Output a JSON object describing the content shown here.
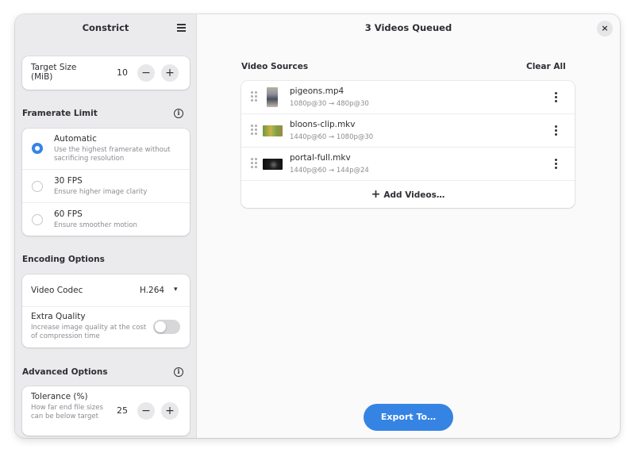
{
  "sidebar": {
    "title": "Constrict",
    "target_size": {
      "label": "Target Size (MiB)",
      "value": "10",
      "decrement": "−",
      "increment": "+"
    },
    "framerate": {
      "title": "Framerate Limit",
      "info": "i",
      "options": [
        {
          "label": "Automatic",
          "desc": "Use the highest framerate without sacrificing resolution",
          "selected": true
        },
        {
          "label": "30 FPS",
          "desc": "Ensure higher image clarity",
          "selected": false
        },
        {
          "label": "60 FPS",
          "desc": "Ensure smoother motion",
          "selected": false
        }
      ]
    },
    "encoding": {
      "title": "Encoding Options",
      "video_codec_label": "Video Codec",
      "video_codec_value": "H.264",
      "extra_quality_label": "Extra Quality",
      "extra_quality_desc": "Increase image quality at the cost of compression time",
      "extra_quality_on": false
    },
    "advanced": {
      "title": "Advanced Options",
      "info": "i",
      "tolerance_label": "Tolerance (%)",
      "tolerance_desc": "How far end file sizes can be below target",
      "tolerance_value": "25",
      "decrement": "−",
      "increment": "+"
    }
  },
  "main": {
    "title": "3 Videos Queued",
    "close": "×",
    "sources_title": "Video Sources",
    "clear_all": "Clear All",
    "videos": [
      {
        "name": "pigeons.mp4",
        "meta": "1080p@30 → 480p@30",
        "thumb": "portrait-thumbnail"
      },
      {
        "name": "bloons-clip.mkv",
        "meta": "1440p@60 → 1080p@30",
        "thumb": "game-thumbnail"
      },
      {
        "name": "portal-full.mkv",
        "meta": "1440p@60 → 144p@24",
        "thumb": "dark-thumbnail"
      }
    ],
    "add_videos": "Add Videos…",
    "add_icon": "+",
    "export": "Export To…"
  },
  "colors": {
    "accent": "#3584e4",
    "sidebar_bg": "#ebebed",
    "window_bg": "#fafafb"
  }
}
